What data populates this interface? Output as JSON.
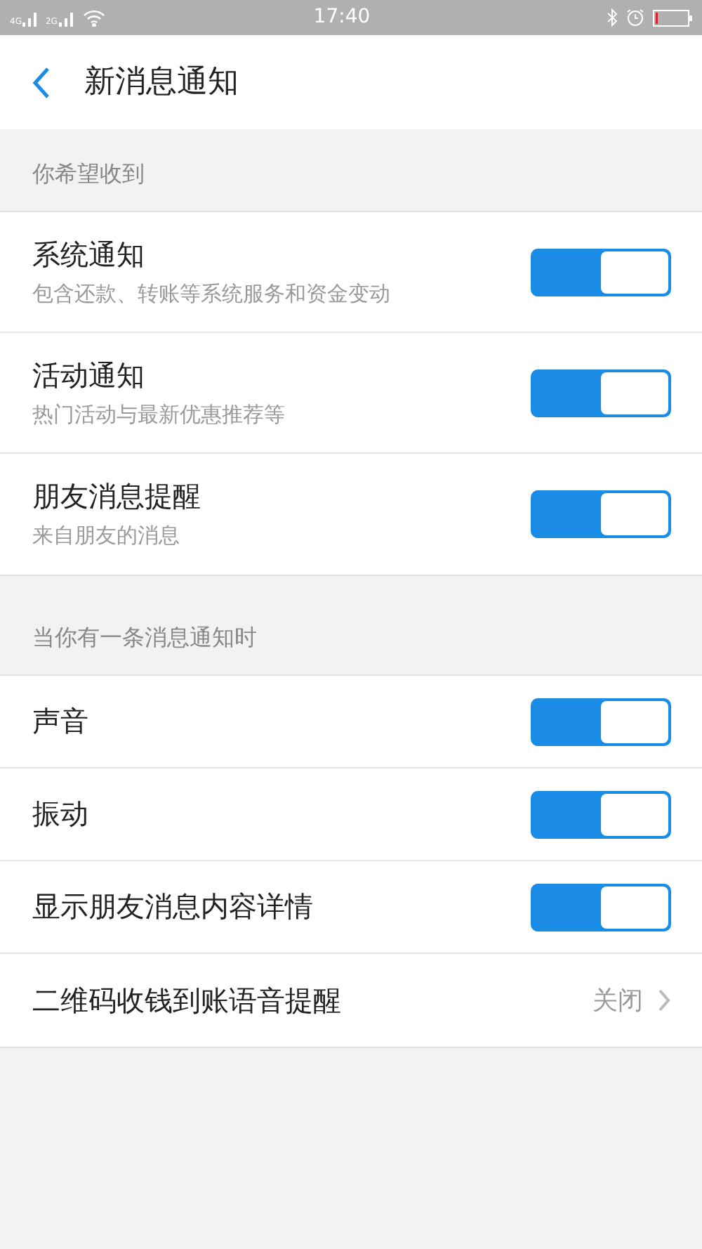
{
  "status_bar": {
    "network_1": "4G",
    "network_2": "2G",
    "time": "17:40"
  },
  "header": {
    "title": "新消息通知"
  },
  "sections": [
    {
      "title": "你希望收到",
      "items": [
        {
          "kind": "toggle",
          "label": "系统通知",
          "subtitle": "包含还款、转账等系统服务和资金变动",
          "on": true
        },
        {
          "kind": "toggle",
          "label": "活动通知",
          "subtitle": "热门活动与最新优惠推荐等",
          "on": true
        },
        {
          "kind": "toggle",
          "label": "朋友消息提醒",
          "subtitle": "来自朋友的消息",
          "on": true
        }
      ]
    },
    {
      "title": "当你有一条消息通知时",
      "items": [
        {
          "kind": "toggle",
          "label": "声音",
          "on": true
        },
        {
          "kind": "toggle",
          "label": "振动",
          "on": true
        },
        {
          "kind": "toggle",
          "label": "显示朋友消息内容详情",
          "on": true
        },
        {
          "kind": "link",
          "label": "二维码收钱到账语音提醒",
          "value": "关闭"
        }
      ]
    }
  ]
}
